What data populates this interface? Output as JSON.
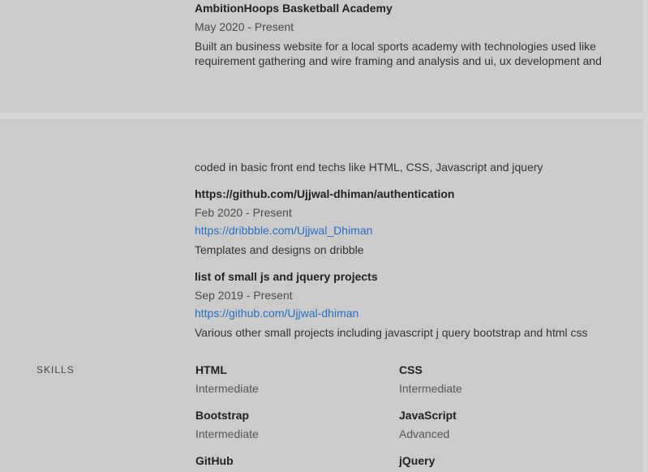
{
  "experience": {
    "title": "AmbitionHoops Basketball Academy",
    "date": "May 2020 - Present",
    "description_line1": "Built an business website for a local sports academy with technologies used like",
    "description_line2": "requirement gathering and wire framing and analysis and ui, ux development and",
    "description_line3": "coded in basic front end techs like HTML, CSS, Javascript and jquery"
  },
  "projects": [
    {
      "title": "https://github.com/Ujjwal-dhiman/authentication",
      "date": "Feb 2020 - Present",
      "link": "https://dribbble.com/Ujjwal_Dhiman",
      "description": "Templates and designs on dribble"
    },
    {
      "title": "list of small js and jquery projects",
      "date": "Sep 2019 - Present",
      "link": "https://github.com/Ujjwal-dhiman",
      "description": "Various other small projects including javascript j query bootstrap and html css"
    }
  ],
  "skills": {
    "label": "SKILLS",
    "items": [
      {
        "name": "HTML",
        "level": "Intermediate"
      },
      {
        "name": "CSS",
        "level": "Intermediate"
      },
      {
        "name": "Bootstrap",
        "level": "Intermediate"
      },
      {
        "name": "JavaScript",
        "level": "Advanced"
      },
      {
        "name": "GitHub",
        "level": ""
      },
      {
        "name": "jQuery",
        "level": ""
      }
    ]
  }
}
